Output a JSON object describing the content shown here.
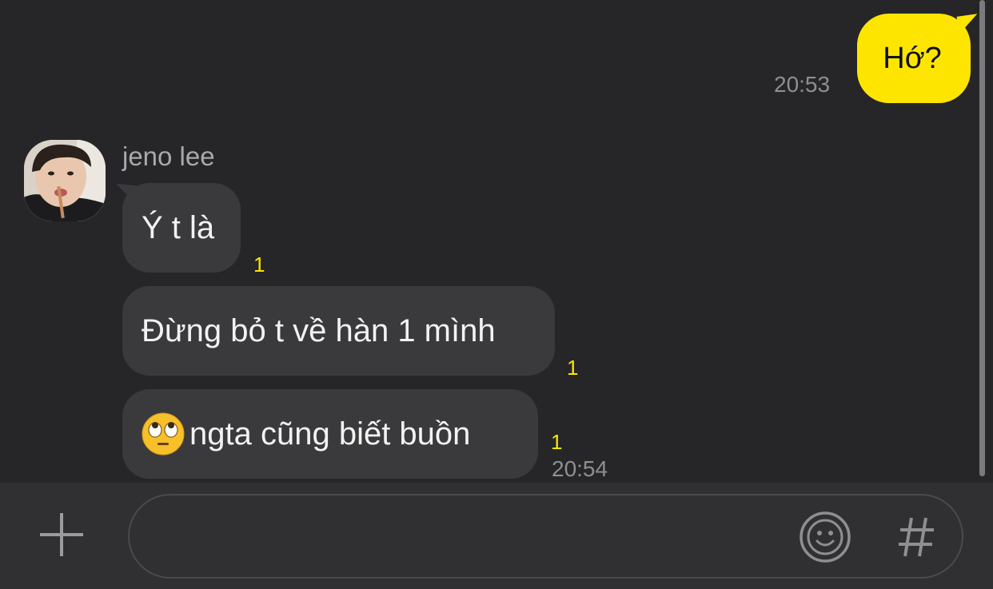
{
  "messages": {
    "outgoing": [
      {
        "text": "Hớ?",
        "time": "20:53"
      }
    ],
    "incoming_group": {
      "sender": "jeno lee",
      "messages": [
        {
          "text": "Ý t là",
          "unread": "1"
        },
        {
          "text": "Đừng bỏ t về hàn 1 mình",
          "unread": "1"
        },
        {
          "emoji": "face-with-rolling-eyes-icon",
          "text": "ngta cũng biết buồn",
          "unread": "1",
          "time": "20:54"
        }
      ]
    }
  },
  "input": {
    "value": "",
    "placeholder": ""
  },
  "colors": {
    "background": "#262628",
    "outgoing_bubble": "#fee500",
    "incoming_bubble": "#3a3a3c",
    "unread_count": "#fee500",
    "timestamp": "#8e8e93"
  },
  "icons": {
    "attach": "plus-icon",
    "emoticon": "smiley-icon",
    "hashtag": "hashtag-icon"
  }
}
